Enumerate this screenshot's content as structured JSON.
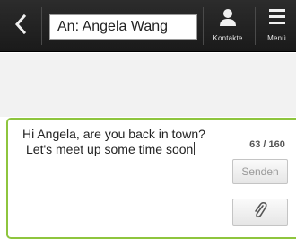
{
  "header": {
    "recipient_field": "An: Angela Wang",
    "contacts_label": "Kontakte",
    "menu_label": "Menü"
  },
  "icons": {
    "back": "chevron-left-icon",
    "contacts": "person-icon",
    "menu": "hamburger-icon",
    "attach": "paperclip-icon"
  },
  "compose": {
    "line1": "Hi Angela, are you back in town?",
    "line2": "Let's meet up some time soon",
    "char_counter": "63 / 160",
    "send_label": "Senden"
  },
  "colors": {
    "header_bg": "#1e1e1e",
    "compose_border": "#8ec53e",
    "content_bg": "#f2f2f2"
  }
}
